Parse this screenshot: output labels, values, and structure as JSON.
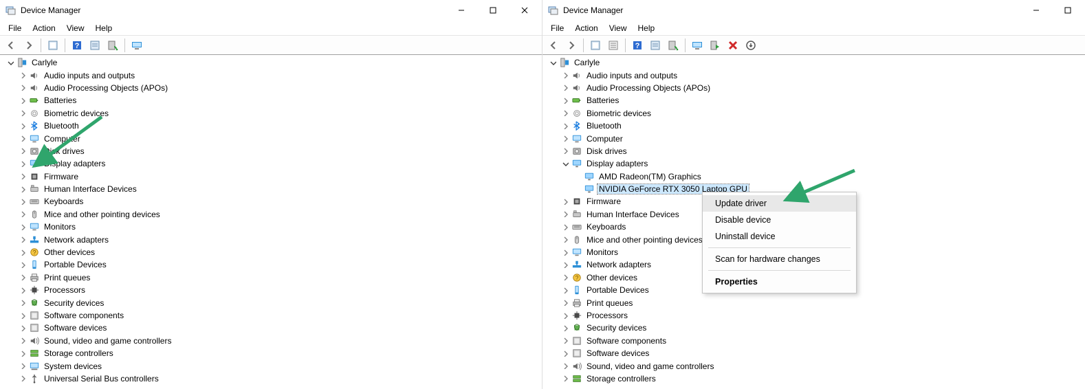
{
  "left": {
    "title": "Device Manager",
    "window_controls": {
      "min": "Minimize",
      "max": "Maximize",
      "close": "Close"
    },
    "menu": [
      "File",
      "Action",
      "View",
      "Help"
    ],
    "toolbar": [
      "back",
      "forward",
      "sep",
      "show-hidden",
      "sep",
      "help",
      "properties",
      "scan",
      "sep",
      "computer"
    ],
    "root": "Carlyle",
    "categories": [
      {
        "label": "Audio inputs and outputs",
        "icon": "speaker"
      },
      {
        "label": "Audio Processing Objects (APOs)",
        "icon": "speaker"
      },
      {
        "label": "Batteries",
        "icon": "battery"
      },
      {
        "label": "Biometric devices",
        "icon": "biometric"
      },
      {
        "label": "Bluetooth",
        "icon": "bluetooth"
      },
      {
        "label": "Computer",
        "icon": "monitor"
      },
      {
        "label": "Disk drives",
        "icon": "disk"
      },
      {
        "label": "Display adapters",
        "icon": "display"
      },
      {
        "label": "Firmware",
        "icon": "firmware"
      },
      {
        "label": "Human Interface Devices",
        "icon": "hid"
      },
      {
        "label": "Keyboards",
        "icon": "keyboard"
      },
      {
        "label": "Mice and other pointing devices",
        "icon": "mouse"
      },
      {
        "label": "Monitors",
        "icon": "monitor"
      },
      {
        "label": "Network adapters",
        "icon": "network"
      },
      {
        "label": "Other devices",
        "icon": "unknown"
      },
      {
        "label": "Portable Devices",
        "icon": "portable"
      },
      {
        "label": "Print queues",
        "icon": "printer"
      },
      {
        "label": "Processors",
        "icon": "cpu"
      },
      {
        "label": "Security devices",
        "icon": "security"
      },
      {
        "label": "Software components",
        "icon": "software"
      },
      {
        "label": "Software devices",
        "icon": "software"
      },
      {
        "label": "Sound, video and game controllers",
        "icon": "sound"
      },
      {
        "label": "Storage controllers",
        "icon": "storage"
      },
      {
        "label": "System devices",
        "icon": "system"
      },
      {
        "label": "Universal Serial Bus controllers",
        "icon": "usb"
      }
    ]
  },
  "right": {
    "title": "Device Manager",
    "window_controls": {
      "min": "Minimize",
      "max": "Maximize"
    },
    "menu": [
      "File",
      "Action",
      "View",
      "Help"
    ],
    "toolbar": [
      "back",
      "forward",
      "sep",
      "show-hidden",
      "properties2",
      "sep",
      "help",
      "properties",
      "scan",
      "sep",
      "computer",
      "enable",
      "disable",
      "uninstall-arrow"
    ],
    "root": "Carlyle",
    "categories": [
      {
        "label": "Audio inputs and outputs",
        "icon": "speaker"
      },
      {
        "label": "Audio Processing Objects (APOs)",
        "icon": "speaker"
      },
      {
        "label": "Batteries",
        "icon": "battery"
      },
      {
        "label": "Biometric devices",
        "icon": "biometric"
      },
      {
        "label": "Bluetooth",
        "icon": "bluetooth"
      },
      {
        "label": "Computer",
        "icon": "monitor"
      },
      {
        "label": "Disk drives",
        "icon": "disk"
      },
      {
        "label": "Display adapters",
        "icon": "display",
        "expanded": true,
        "children": [
          {
            "label": "AMD Radeon(TM) Graphics",
            "icon": "display"
          },
          {
            "label": "NVIDIA GeForce RTX 3050 Laptop GPU",
            "icon": "display",
            "selected": true
          }
        ]
      },
      {
        "label": "Firmware",
        "icon": "firmware"
      },
      {
        "label": "Human Interface Devices",
        "icon": "hid"
      },
      {
        "label": "Keyboards",
        "icon": "keyboard"
      },
      {
        "label": "Mice and other pointing devices",
        "icon": "mouse"
      },
      {
        "label": "Monitors",
        "icon": "monitor"
      },
      {
        "label": "Network adapters",
        "icon": "network"
      },
      {
        "label": "Other devices",
        "icon": "unknown"
      },
      {
        "label": "Portable Devices",
        "icon": "portable"
      },
      {
        "label": "Print queues",
        "icon": "printer"
      },
      {
        "label": "Processors",
        "icon": "cpu"
      },
      {
        "label": "Security devices",
        "icon": "security"
      },
      {
        "label": "Software components",
        "icon": "software"
      },
      {
        "label": "Software devices",
        "icon": "software"
      },
      {
        "label": "Sound, video and game controllers",
        "icon": "sound"
      },
      {
        "label": "Storage controllers",
        "icon": "storage"
      }
    ],
    "context_menu": {
      "items": [
        {
          "label": "Update driver",
          "hover": true
        },
        {
          "label": "Disable device"
        },
        {
          "label": "Uninstall device"
        },
        {
          "sep": true
        },
        {
          "label": "Scan for hardware changes"
        },
        {
          "sep": true
        },
        {
          "label": "Properties",
          "bold": true
        }
      ]
    }
  }
}
